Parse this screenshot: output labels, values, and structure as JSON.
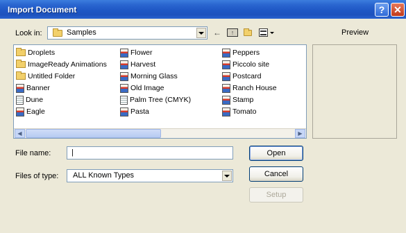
{
  "window": {
    "title": "Import Document",
    "help_button": "?",
    "close_button": "✕"
  },
  "lookin": {
    "label": "Look in:",
    "value": "Samples",
    "icon": "folder-icon"
  },
  "toolbar": {
    "back_icon": "back-arrow-icon",
    "up_icon": "up-folder-icon",
    "new_folder_icon": "new-folder-icon",
    "view_menu_icon": "view-menu-icon"
  },
  "files": {
    "columns": [
      [
        {
          "name": "Droplets",
          "icon": "folder"
        },
        {
          "name": "ImageReady Animations",
          "icon": "folder"
        },
        {
          "name": "Untitled Folder",
          "icon": "folder"
        },
        {
          "name": "Banner",
          "icon": "image"
        },
        {
          "name": "Dune",
          "icon": "document"
        },
        {
          "name": "Eagle",
          "icon": "image"
        }
      ],
      [
        {
          "name": "Flower",
          "icon": "image"
        },
        {
          "name": "Harvest",
          "icon": "image"
        },
        {
          "name": "Morning Glass",
          "icon": "image"
        },
        {
          "name": "Old Image",
          "icon": "image"
        },
        {
          "name": "Palm Tree (CMYK)",
          "icon": "document"
        },
        {
          "name": "Pasta",
          "icon": "image"
        }
      ],
      [
        {
          "name": "Peppers",
          "icon": "image"
        },
        {
          "name": "Piccolo site",
          "icon": "image"
        },
        {
          "name": "Postcard",
          "icon": "image"
        },
        {
          "name": "Ranch House",
          "icon": "image"
        },
        {
          "name": "Stamp",
          "icon": "image"
        },
        {
          "name": "Tomato",
          "icon": "image"
        }
      ]
    ]
  },
  "preview": {
    "label": "Preview"
  },
  "filename": {
    "label": "File name:",
    "value": "|"
  },
  "filetype": {
    "label": "Files of type:",
    "value": "ALL Known Types"
  },
  "buttons": {
    "open": "Open",
    "cancel": "Cancel",
    "setup": "Setup"
  }
}
